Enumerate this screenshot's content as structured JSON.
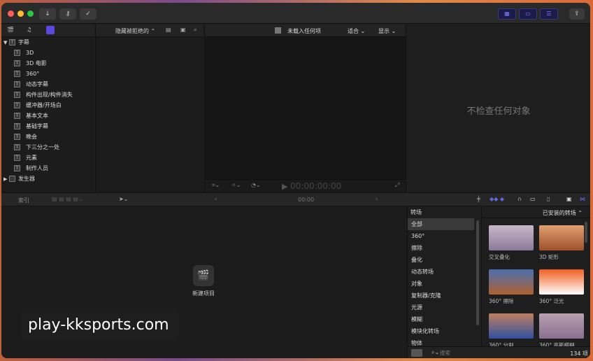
{
  "titlebar": {
    "download_icon": "download-icon",
    "key_icon": "key-icon",
    "check_icon": "check-icon",
    "share_icon": "share-icon"
  },
  "library": {
    "filter": "隐藏被拒绝的 ⌃",
    "group": "字幕",
    "items": [
      "3D",
      "3D 电影",
      "360°",
      "动态字幕",
      "构件出现/构件消失",
      "缓冲器/开场白",
      "基本文本",
      "基础字幕",
      "晚会",
      "下三分之一处",
      "元素",
      "制作人员"
    ],
    "generators": "发生器"
  },
  "viewer": {
    "status": "未载入任何项",
    "fit": "适合",
    "display": "显示",
    "timecode": "00:00:00:00"
  },
  "inspector": {
    "empty": "不检查任何对象"
  },
  "timeline": {
    "index": "索引",
    "timecode": "00:00",
    "new_project": "新建项目"
  },
  "transitions": {
    "title": "转场",
    "installed": "已安装的转场",
    "categories": [
      "全部",
      "360°",
      "擦除",
      "叠化",
      "动态转场",
      "对象",
      "复制器/克隆",
      "光源",
      "模糊",
      "模块化转场",
      "物体"
    ],
    "items": [
      {
        "label": "交叉叠化",
        "colors": [
          "#8a7a9a",
          "#c8b8c8"
        ]
      },
      {
        "label": "3D 矩形",
        "colors": [
          "#a0502a",
          "#e0a070"
        ]
      },
      {
        "label": "360° 擦除",
        "colors": [
          "#b06030",
          "#4a70b0"
        ]
      },
      {
        "label": "360° 泛光",
        "colors": [
          "#ffffff",
          "#f06020"
        ]
      },
      {
        "label": "360° 分割",
        "colors": [
          "#3050a0",
          "#c08060"
        ]
      },
      {
        "label": "360° 高斯模糊",
        "colors": [
          "#8a7090",
          "#b8a0b0"
        ]
      }
    ],
    "search_placeholder": "搜索",
    "count": "134 项"
  },
  "watermark": "play-kksports.com"
}
